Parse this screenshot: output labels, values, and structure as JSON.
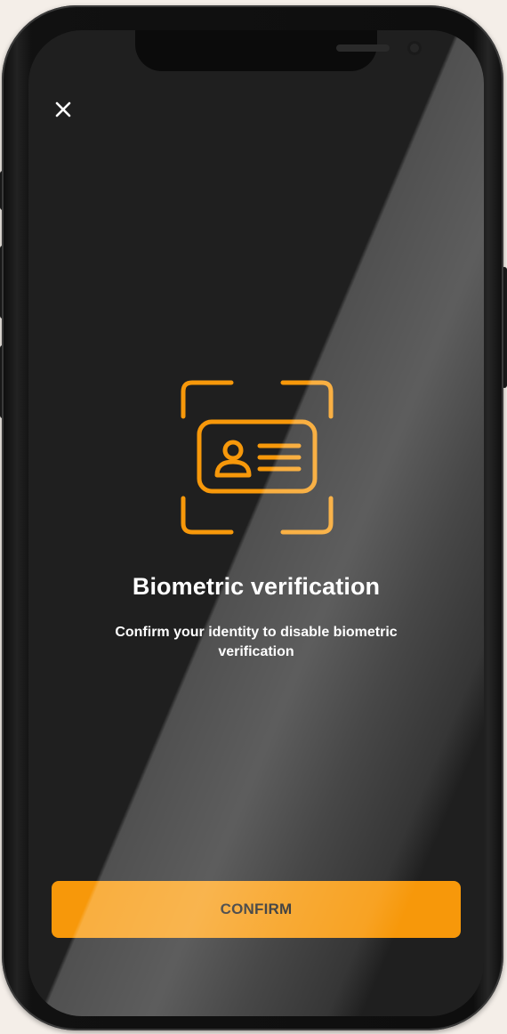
{
  "screen": {
    "title": "Biometric verification",
    "subtitle": "Confirm your identity to disable biometric verification",
    "confirm_label": "CONFIRM",
    "close_icon": "close-icon",
    "hero_icon": "id-card-scan-icon"
  },
  "colors": {
    "accent": "#f7980a",
    "background": "#1f1f1f",
    "text": "#ffffff"
  }
}
